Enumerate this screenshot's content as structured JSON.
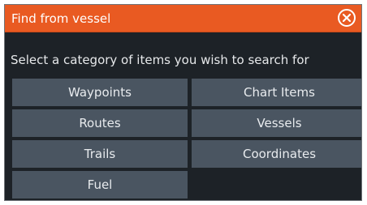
{
  "dialog": {
    "title": "Find from vessel",
    "close_icon": "close-circle-icon",
    "prompt": "Select a category of items you wish to search for",
    "categories": [
      {
        "label": "Waypoints"
      },
      {
        "label": "Chart Items"
      },
      {
        "label": "Routes"
      },
      {
        "label": "Vessels"
      },
      {
        "label": "Trails"
      },
      {
        "label": "Coordinates"
      },
      {
        "label": "Fuel"
      }
    ]
  },
  "colors": {
    "titlebar": "#e95a22",
    "background": "#1d2227",
    "button": "#4a5561",
    "text": "#e8ebee"
  }
}
